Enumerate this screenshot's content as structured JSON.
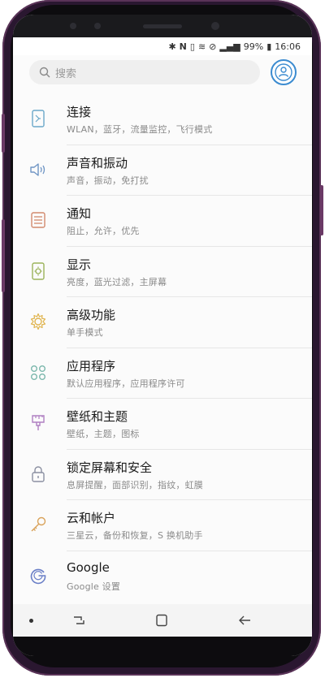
{
  "status": {
    "battery": "99%",
    "time": "16:06"
  },
  "search": {
    "placeholder": "搜索"
  },
  "settings": [
    {
      "title": "连接",
      "subtitle": "WLAN，蓝牙，流量监控，飞行模式",
      "icon": "connection-icon",
      "color": "#6aa8c9"
    },
    {
      "title": "声音和振动",
      "subtitle": "声音，振动，免打扰",
      "icon": "sound-icon",
      "color": "#6f95c4"
    },
    {
      "title": "通知",
      "subtitle": "阻止，允许，优先",
      "icon": "notification-icon",
      "color": "#d2896d"
    },
    {
      "title": "显示",
      "subtitle": "亮度，蓝光过滤，主屏幕",
      "icon": "display-icon",
      "color": "#9bb35a"
    },
    {
      "title": "高级功能",
      "subtitle": "单手模式",
      "icon": "advanced-features-icon",
      "color": "#e0b44e"
    },
    {
      "title": "应用程序",
      "subtitle": "默认应用程序，应用程序许可",
      "icon": "apps-icon",
      "color": "#7cb8ad"
    },
    {
      "title": "壁纸和主题",
      "subtitle": "壁纸，主题，图标",
      "icon": "theme-brush-icon",
      "color": "#b07fc2"
    },
    {
      "title": "锁定屏幕和安全",
      "subtitle": "息屏提醒，面部识别，指纹，虹膜",
      "icon": "lock-icon",
      "color": "#8b8fa1"
    },
    {
      "title": "云和帐户",
      "subtitle": "三星云，备份和恢复，S 换机助手",
      "icon": "key-icon",
      "color": "#d9a25a"
    },
    {
      "title": "Google",
      "subtitle": "Google 设置",
      "icon": "google-icon",
      "color": "#6a7fc7"
    }
  ]
}
